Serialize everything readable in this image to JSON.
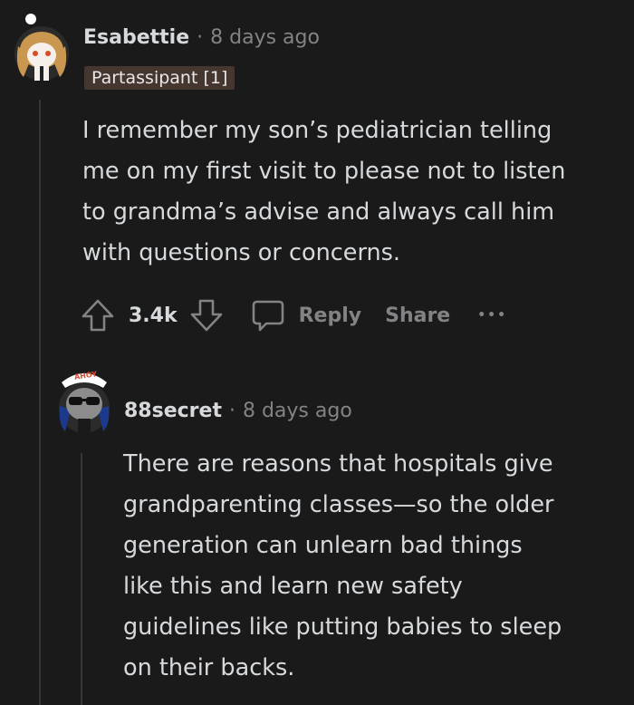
{
  "comment": {
    "username": "Esabettie",
    "separator": "·",
    "time_ago": "8 days ago",
    "flair": "Partassipant [1]",
    "body_lines": [
      "I remember my son’s pediatrician telling",
      "me on my first visit to please not to listen",
      "to grandma’s advise and always call him",
      "with questions or concerns."
    ],
    "actions": {
      "upvote_count": "3.4k",
      "reply_label": "Reply",
      "share_label": "Share",
      "more_label": "•••"
    }
  },
  "reply": {
    "username": "88secret",
    "separator": "·",
    "time_ago": "8 days ago",
    "avatar_hat_text": "AHOY",
    "body_lines": [
      "There are reasons that hospitals give",
      "grandparenting classes—so the older",
      "generation can unlearn bad things",
      "like this and learn new safety",
      "guidelines like putting babies to sleep",
      "on their backs."
    ]
  },
  "colors": {
    "background": "#1a1a1b",
    "text": "#d7dadc",
    "muted": "#818384",
    "flair_bg": "#45362f",
    "thread_line": "#343536"
  },
  "icons": [
    "upvote-arrow-icon",
    "downvote-arrow-icon",
    "comment-bubble-icon",
    "more-options-icon"
  ]
}
